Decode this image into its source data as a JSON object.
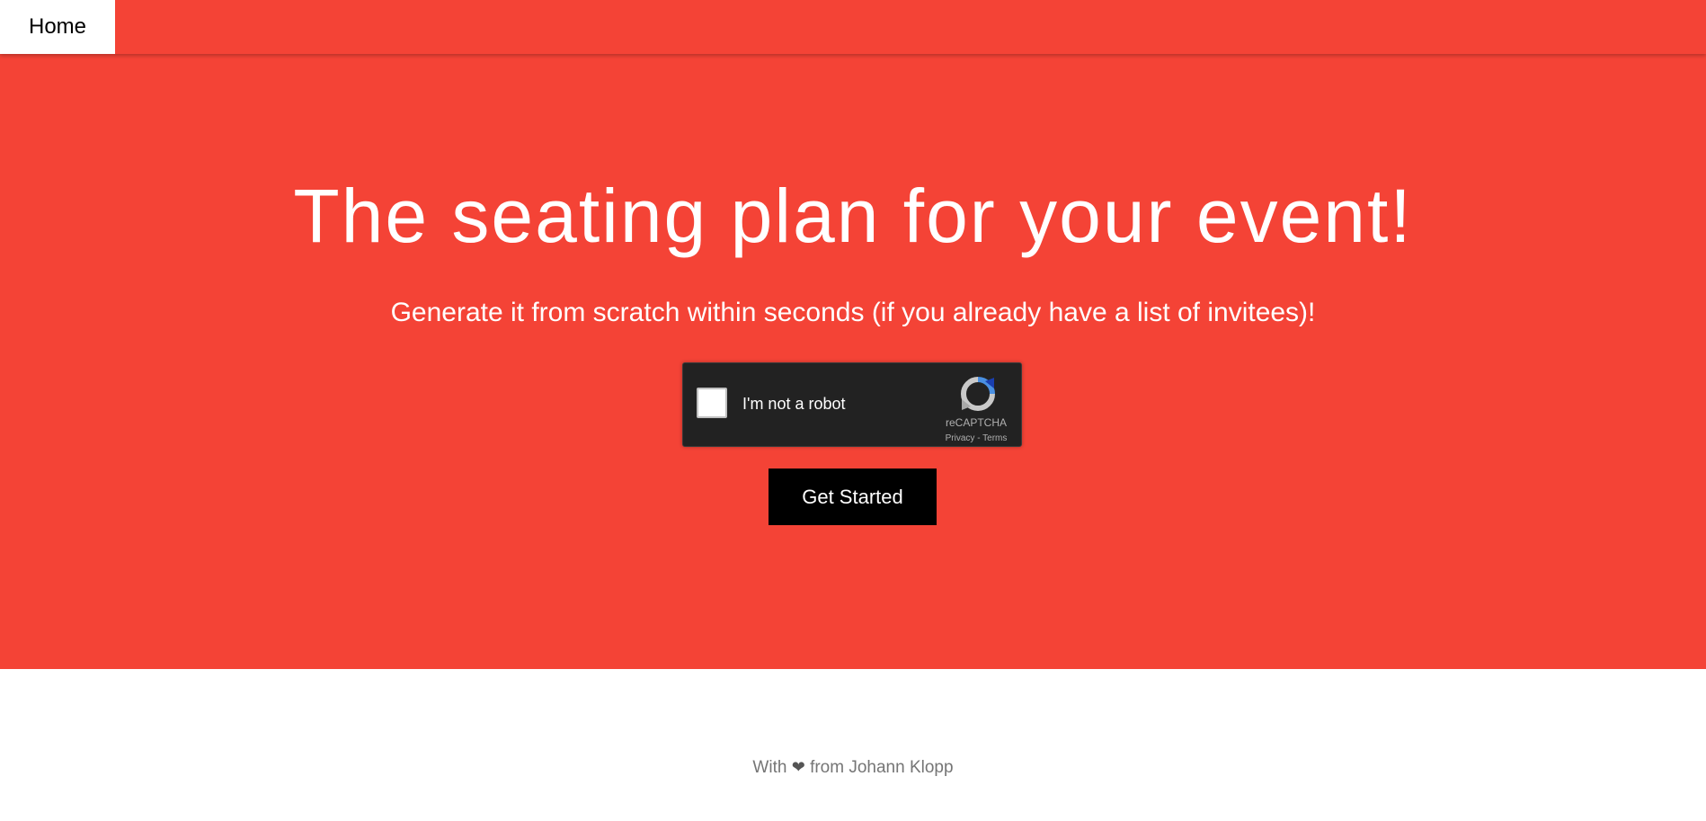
{
  "nav": {
    "home_label": "Home"
  },
  "hero": {
    "title": "The seating plan for your event!",
    "subtitle": "Generate it from scratch within seconds (if you already have a list of invitees)!",
    "background_color": "#f44336"
  },
  "recaptcha": {
    "checkbox_label": "I'm not a robot",
    "brand": "reCAPTCHA",
    "privacy_label": "Privacy",
    "separator": " - ",
    "terms_label": "Terms",
    "icon": "recaptcha-logo-icon"
  },
  "cta": {
    "label": "Get Started"
  },
  "footer": {
    "prefix": "With",
    "icon": "heart-icon",
    "heart_glyph": "❤",
    "suffix": "from Johann Klopp"
  }
}
